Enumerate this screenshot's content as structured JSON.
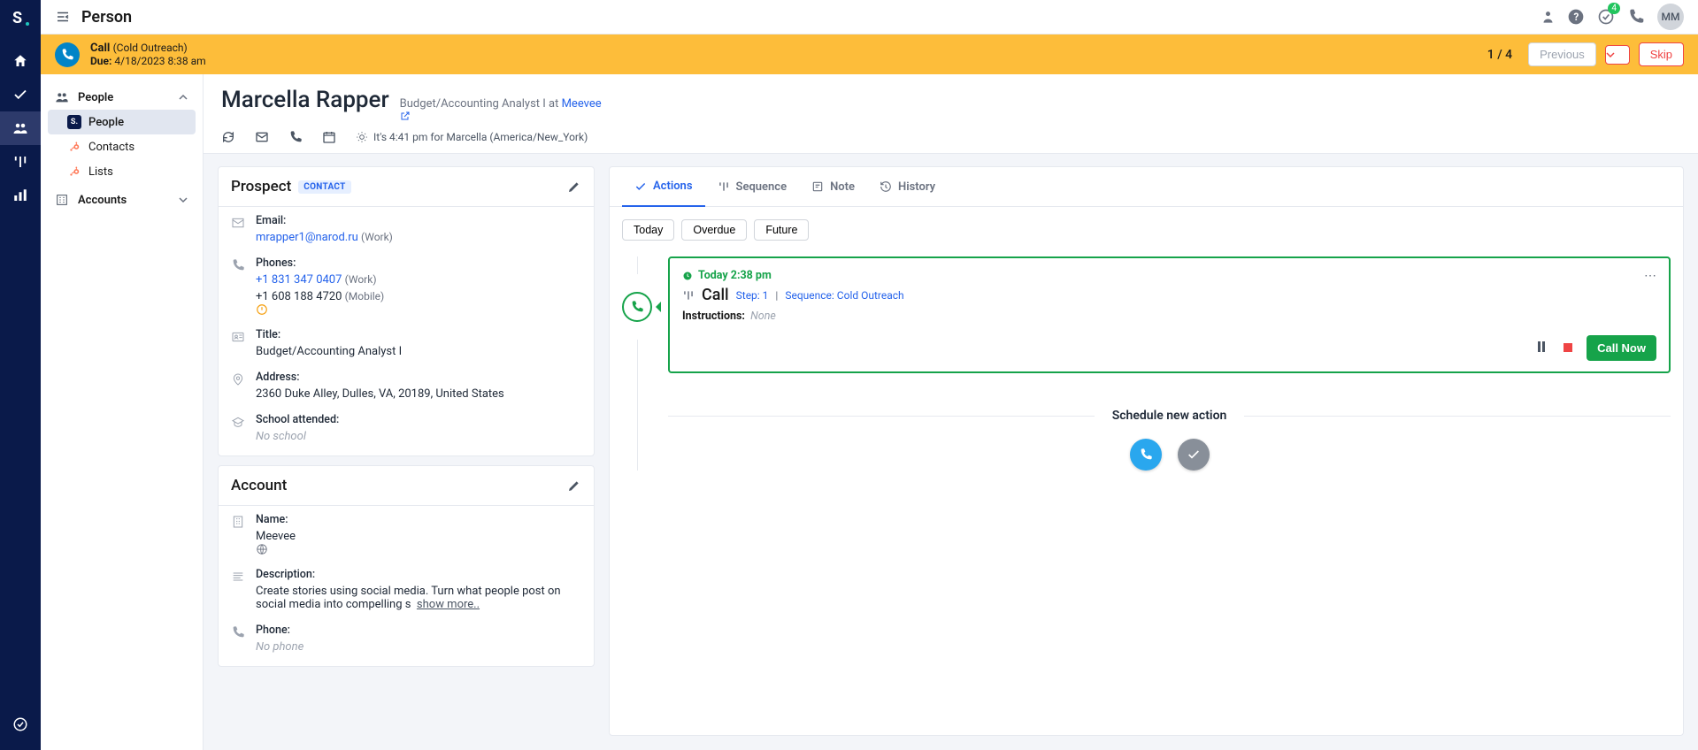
{
  "topbar": {
    "title": "Person",
    "notification_count": "4",
    "avatar": "MM"
  },
  "banner": {
    "action": "Call",
    "action_sub": "(Cold Outreach)",
    "due_label": "Due:",
    "due_value": "4/18/2023 8:38 am",
    "counter": "1 / 4",
    "previous": "Previous",
    "skip": "Skip"
  },
  "sidebar": {
    "people_group": "People",
    "people": "People",
    "contacts": "Contacts",
    "lists": "Lists",
    "accounts": "Accounts"
  },
  "person": {
    "name": "Marcella Rapper",
    "role": "Budget/Accounting Analyst I at ",
    "company": "Meevee",
    "local_time": "It's 4:41 pm for Marcella (America/New_York)"
  },
  "prospect": {
    "card_title": "Prospect",
    "tag": "CONTACT",
    "email_label": "Email:",
    "email": "mrapper1@narod.ru",
    "email_type": "(Work)",
    "phones_label": "Phones:",
    "phone1": "+1 831 347 0407",
    "phone1_type": "(Work)",
    "phone2": "+1 608 188 4720",
    "phone2_type": "(Mobile)",
    "title_label": "Title:",
    "title_value": "Budget/Accounting Analyst I",
    "address_label": "Address:",
    "address_value": "2360 Duke Alley, Dulles, VA, 20189, United States",
    "school_label": "School attended:",
    "school_value": "No school"
  },
  "account": {
    "card_title": "Account",
    "name_label": "Name:",
    "name_value": "Meevee",
    "desc_label": "Description:",
    "desc_value": "Create stories using social media. Turn what people post on social media into compelling s",
    "show_more": "show more..",
    "phone_label": "Phone:",
    "phone_value": "No phone"
  },
  "tabs": {
    "actions": "Actions",
    "sequence": "Sequence",
    "note": "Note",
    "history": "History",
    "pill_today": "Today",
    "pill_overdue": "Overdue",
    "pill_future": "Future"
  },
  "action": {
    "time": "Today 2:38 pm",
    "title": "Call",
    "step": "Step: 1",
    "sep": "|",
    "sequence": "Sequence: Cold Outreach",
    "instr_label": "Instructions:",
    "instr_value": "None",
    "call_now": "Call Now"
  },
  "schedule": {
    "label": "Schedule new action"
  }
}
